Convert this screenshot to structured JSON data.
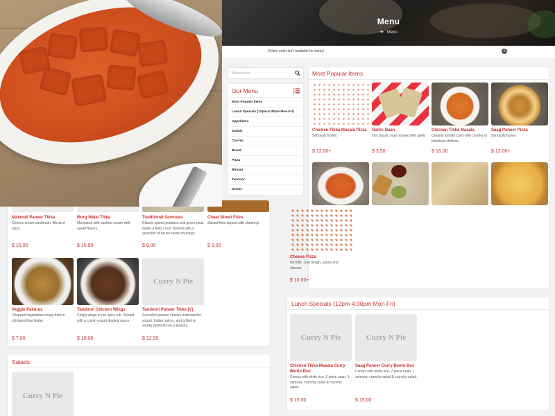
{
  "header": {
    "title": "Menu",
    "breadcrumb": "Menu"
  },
  "notice": {
    "text": "Online order isn't available for today!"
  },
  "search": {
    "placeholder": "Search food"
  },
  "sidebar": {
    "title": "Our Menu",
    "items": [
      "Most Popular Items",
      "Lunch Specials (12pm-4:30pm Mon-Fri)",
      "Appetizers",
      "Salads",
      "Curries",
      "Bread",
      "Pizza",
      "Biryani",
      "Tandoor",
      "Drinks"
    ]
  },
  "popular": {
    "title": "Most Popular Items",
    "items": [
      {
        "name": "Chicken Tikka Masala Pizza",
        "desc": "Seriously fusion.",
        "price": "$ 12.00+"
      },
      {
        "name": "Garlic Naan",
        "desc": "Our classic naan topped with garlic",
        "price": "$ 3.50"
      },
      {
        "name": "Chicken Tikka Masala",
        "desc": "Creamy tomato curry with chunks of boneless chicken.",
        "price": "$ 16.00"
      },
      {
        "name": "Saag Paneer Pizza",
        "desc": "Seriously fusion.",
        "price": "$ 12.00+"
      }
    ],
    "cheese": {
      "name": "Cheese Pizza",
      "desc": "No frills. Just dough, sauce and cheese.",
      "price": "$ 10.00+"
    }
  },
  "appetizers": {
    "row1": [
      {
        "name": "Makmali Paneer Tikka",
        "desc": "Cheese cream cardimum. Blend of spicy.",
        "price": "$ 15.00"
      },
      {
        "name": "Murg Malai Tikka",
        "desc": "Marinated with cashew cream with sweet flavors.",
        "price": "$ 15.99"
      },
      {
        "name": "Traditional Samosas",
        "desc": "Classic spiced potatoes and green peas inside a flaky crust. Served with a selection of house-made chutneys.",
        "price": "$ 8.00"
      },
      {
        "name": "Chaat Street Fries",
        "desc": "Spiced fries topped with chutneys",
        "price": "$ 9.00"
      }
    ],
    "row2": [
      {
        "name": "Veggie Pakoras",
        "desc": "Chopped vegetables crispy fried in chickpea flour batter.",
        "price": "$ 7.00"
      },
      {
        "name": "Tandoori Chicken Wings",
        "desc": "Crispy wings in our spicy rub. Served with a cumin yogurt dipping sauce.",
        "price": "$ 10.00"
      },
      {
        "name": "Tandoori Paneer Tikka (V)",
        "desc": "Succulent paneer chunks marinated in yogurt, Indian spices, and grilled to smoky perfection in a tandoor.",
        "price": "$ 12.99"
      }
    ]
  },
  "placeholder_text": "Curry N Pie",
  "salads": {
    "title": "Salads"
  },
  "lunch": {
    "title": "Lunch Specials (12pm-4:30pm Mon-Fri)",
    "items": [
      {
        "name": "Chicken Tikka Masala Curry Bento Box",
        "desc": "Comes with white rice, 2 piece naan, 1 samosa, crunchy salad & crunchy salad.",
        "price": "$ 15.00"
      },
      {
        "name": "Saag Paneer Curry Bento Box",
        "desc": "Comes with white rice, 2 piece naan, 1 samosa, crunchy salad & crunchy salad.",
        "price": "$ 15.00"
      }
    ]
  },
  "colors": {
    "accent": "#c9302c",
    "text": "#222222",
    "bg": "#f2f2f2"
  }
}
